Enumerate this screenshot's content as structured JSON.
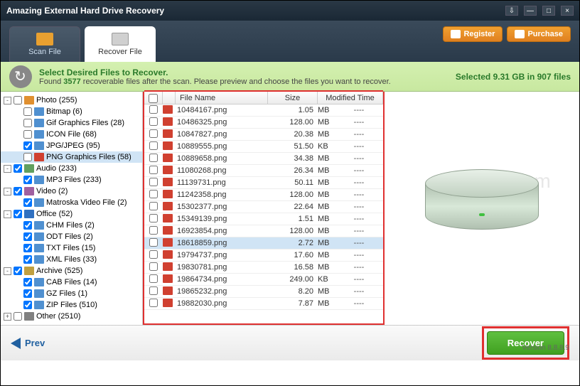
{
  "window": {
    "title": "Amazing External Hard Drive Recovery"
  },
  "top_buttons": {
    "register": "Register",
    "purchase": "Purchase"
  },
  "tabs": {
    "scan": "Scan File",
    "recover": "Recover File"
  },
  "info": {
    "title": "Select Desired Files to Recover.",
    "found_prefix": "Found ",
    "found_count": "3577",
    "found_suffix": " recoverable files after the scan. Please preview and choose the files you want to recover.",
    "selected": "Selected 9.31 GB in 907 files"
  },
  "tree": [
    {
      "level": 0,
      "toggle": "-",
      "checked": false,
      "icon": "ico-photo",
      "label": "Photo (255)"
    },
    {
      "level": 1,
      "toggle": "",
      "checked": false,
      "icon": "ico-file",
      "label": "Bitmap (6)"
    },
    {
      "level": 1,
      "toggle": "",
      "checked": false,
      "icon": "ico-file",
      "label": "Gif Graphics Files (28)"
    },
    {
      "level": 1,
      "toggle": "",
      "checked": false,
      "icon": "ico-file",
      "label": "ICON File (68)"
    },
    {
      "level": 1,
      "toggle": "",
      "checked": true,
      "icon": "ico-file",
      "label": "JPG/JPEG (95)"
    },
    {
      "level": 1,
      "toggle": "",
      "checked": false,
      "icon": "ico-png",
      "label": "PNG Graphics Files (58)",
      "selected": true
    },
    {
      "level": 0,
      "toggle": "-",
      "checked": true,
      "icon": "ico-audio",
      "label": "Audio (233)"
    },
    {
      "level": 1,
      "toggle": "",
      "checked": true,
      "icon": "ico-file",
      "label": "MP3 Files (233)"
    },
    {
      "level": 0,
      "toggle": "-",
      "checked": true,
      "icon": "ico-video",
      "label": "Video (2)"
    },
    {
      "level": 1,
      "toggle": "",
      "checked": true,
      "icon": "ico-file",
      "label": "Matroska Video File (2)"
    },
    {
      "level": 0,
      "toggle": "-",
      "checked": true,
      "icon": "ico-office",
      "label": "Office (52)"
    },
    {
      "level": 1,
      "toggle": "",
      "checked": true,
      "icon": "ico-file",
      "label": "CHM Files (2)"
    },
    {
      "level": 1,
      "toggle": "",
      "checked": true,
      "icon": "ico-file",
      "label": "ODT Files (2)"
    },
    {
      "level": 1,
      "toggle": "",
      "checked": true,
      "icon": "ico-file",
      "label": "TXT Files (15)"
    },
    {
      "level": 1,
      "toggle": "",
      "checked": true,
      "icon": "ico-file",
      "label": "XML Files (33)"
    },
    {
      "level": 0,
      "toggle": "-",
      "checked": true,
      "icon": "ico-archive",
      "label": "Archive (525)"
    },
    {
      "level": 1,
      "toggle": "",
      "checked": true,
      "icon": "ico-file",
      "label": "CAB Files (14)"
    },
    {
      "level": 1,
      "toggle": "",
      "checked": true,
      "icon": "ico-file",
      "label": "GZ Files (1)"
    },
    {
      "level": 1,
      "toggle": "",
      "checked": true,
      "icon": "ico-file",
      "label": "ZIP Files (510)"
    },
    {
      "level": 0,
      "toggle": "+",
      "checked": false,
      "icon": "ico-other",
      "label": "Other (2510)"
    }
  ],
  "table": {
    "headers": {
      "name": "File Name",
      "size": "Size",
      "modified": "Modified Time"
    },
    "rows": [
      {
        "name": "10484167.png",
        "size": "1.05",
        "unit": "MB",
        "mod": "----"
      },
      {
        "name": "10486325.png",
        "size": "128.00",
        "unit": "MB",
        "mod": "----"
      },
      {
        "name": "10847827.png",
        "size": "20.38",
        "unit": "MB",
        "mod": "----"
      },
      {
        "name": "10889555.png",
        "size": "51.50",
        "unit": "KB",
        "mod": "----"
      },
      {
        "name": "10889658.png",
        "size": "34.38",
        "unit": "MB",
        "mod": "----"
      },
      {
        "name": "11080268.png",
        "size": "26.34",
        "unit": "MB",
        "mod": "----"
      },
      {
        "name": "11139731.png",
        "size": "50.11",
        "unit": "MB",
        "mod": "----"
      },
      {
        "name": "11242358.png",
        "size": "128.00",
        "unit": "MB",
        "mod": "----"
      },
      {
        "name": "15302377.png",
        "size": "22.64",
        "unit": "MB",
        "mod": "----"
      },
      {
        "name": "15349139.png",
        "size": "1.51",
        "unit": "MB",
        "mod": "----"
      },
      {
        "name": "16923854.png",
        "size": "128.00",
        "unit": "MB",
        "mod": "----"
      },
      {
        "name": "18618859.png",
        "size": "2.72",
        "unit": "MB",
        "mod": "----",
        "selected": true
      },
      {
        "name": "19794737.png",
        "size": "17.60",
        "unit": "MB",
        "mod": "----"
      },
      {
        "name": "19830781.png",
        "size": "16.58",
        "unit": "MB",
        "mod": "----"
      },
      {
        "name": "19864734.png",
        "size": "249.00",
        "unit": "KB",
        "mod": "----"
      },
      {
        "name": "19865232.png",
        "size": "8.20",
        "unit": "MB",
        "mod": "----"
      },
      {
        "name": "19882030.png",
        "size": "7.87",
        "unit": "MB",
        "mod": "----"
      }
    ]
  },
  "watermark": "apkxz.com",
  "buttons": {
    "prev": "Prev",
    "recover": "Recover"
  },
  "version": "Version 8.8.8.9"
}
